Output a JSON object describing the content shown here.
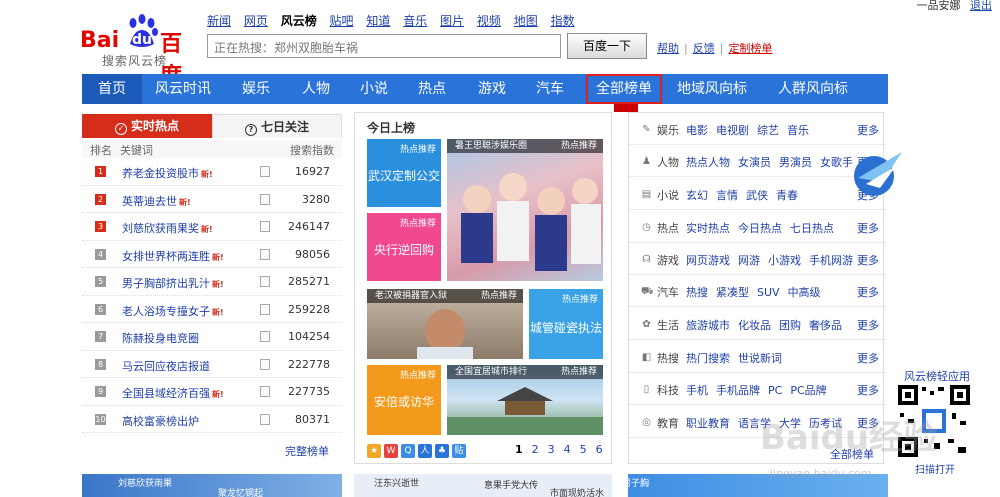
{
  "user": {
    "name": "一品安娜",
    "logout": "退出"
  },
  "logo": {
    "bai": "Bai",
    "du": "du",
    "baidu_cn": "百度",
    "sub": "搜索风云榜"
  },
  "prodnav": [
    "新闻",
    "网页",
    "风云榜",
    "贴吧",
    "知道",
    "音乐",
    "图片",
    "视频",
    "地图",
    "指数"
  ],
  "search": {
    "placeholder": "正在热搜：郑州双胞胎车祸",
    "button": "百度一下"
  },
  "links": {
    "help": "帮助",
    "feedback": "反馈",
    "custom": "定制榜单"
  },
  "mainnav": [
    "首页",
    "风云时讯",
    "娱乐",
    "人物",
    "小说",
    "热点",
    "游戏",
    "汽车",
    "全部榜单",
    "地域风向标",
    "人群风向标"
  ],
  "leftpanel": {
    "tab1": "实时热点",
    "tab2": "七日关注",
    "head_rank": "排名",
    "head_kw": "关键词",
    "head_idx": "搜索指数",
    "rows": [
      {
        "rank": "1",
        "kw": "养老金投资股市",
        "isnew": true,
        "num": "16927"
      },
      {
        "rank": "2",
        "kw": "英蒂迪去世",
        "isnew": true,
        "num": "3280"
      },
      {
        "rank": "3",
        "kw": "刘慈欣获雨果奖",
        "isnew": true,
        "num": "246147"
      },
      {
        "rank": "4",
        "kw": "女排世界杯两连胜",
        "isnew": true,
        "num": "98056"
      },
      {
        "rank": "5",
        "kw": "男子胸部挤出乳汁",
        "isnew": true,
        "num": "285271"
      },
      {
        "rank": "6",
        "kw": "老人浴场专撞女子",
        "isnew": true,
        "num": "259228"
      },
      {
        "rank": "7",
        "kw": "陈赫投身电竞圈",
        "isnew": false,
        "num": "104254"
      },
      {
        "rank": "8",
        "kw": "马云回应夜店报道",
        "isnew": false,
        "num": "222778"
      },
      {
        "rank": "9",
        "kw": "全国县域经济百强",
        "isnew": true,
        "num": "227735"
      },
      {
        "rank": "10",
        "kw": "高校富豪榜出炉",
        "isnew": false,
        "num": "80371"
      }
    ],
    "new_label": "新!",
    "more": "完整榜单"
  },
  "midpanel": {
    "title": "今日上榜",
    "tag": "热点推荐",
    "t1": "武汉定制公交",
    "t2": "央行逆回购",
    "p1": "暑王思聪涉娱乐圈",
    "p2": "老汉被捐器官入狱",
    "t3": "城管碰瓷执法",
    "t4": "安倍或访华",
    "p3": "全国宜居城市排行",
    "pages": [
      "1",
      "2",
      "3",
      "4",
      "5",
      "6"
    ]
  },
  "rightpanel": {
    "rows": [
      {
        "icon": "✎",
        "name": "娱乐",
        "links": [
          "电影",
          "电视剧",
          "综艺",
          "音乐"
        ]
      },
      {
        "icon": "♟",
        "name": "人物",
        "links": [
          "热点人物",
          "女演员",
          "男演员",
          "女歌手"
        ]
      },
      {
        "icon": "▤",
        "name": "小说",
        "links": [
          "玄幻",
          "言情",
          "武侠",
          "青春"
        ]
      },
      {
        "icon": "◷",
        "name": "热点",
        "links": [
          "实时热点",
          "今日热点",
          "七日热点"
        ]
      },
      {
        "icon": "☊",
        "name": "游戏",
        "links": [
          "网页游戏",
          "网游",
          "小游戏",
          "手机网游"
        ]
      },
      {
        "icon": "⛟",
        "name": "汽车",
        "links": [
          "热搜",
          "紧凑型",
          "SUV",
          "中高级"
        ]
      },
      {
        "icon": "✿",
        "name": "生活",
        "links": [
          "旅游城市",
          "化妆品",
          "团购",
          "奢侈品"
        ]
      },
      {
        "icon": "◧",
        "name": "热搜",
        "links": [
          "热门搜索",
          "世说新词"
        ]
      },
      {
        "icon": "▯",
        "name": "科技",
        "links": [
          "手机",
          "手机品牌",
          "PC",
          "PC品牌"
        ]
      },
      {
        "icon": "◎",
        "name": "教育",
        "links": [
          "职业教育",
          "语言学",
          "大学",
          "历考试"
        ]
      }
    ],
    "more": "更多",
    "all": "全部榜单"
  },
  "qr": {
    "label": "风云榜轻应用",
    "scan": "扫描打开"
  },
  "bottom": [
    "刘慈欣获雨果",
    "聚龙忆钢起",
    "汪东兴逝世",
    "意果手党大传",
    "市面现奶活水",
    "男子胸"
  ],
  "watermark": {
    "text": "Baidu经验",
    "url": "jingyan.baidu.com"
  },
  "colors": {
    "nav_blue": "#2a73d9",
    "red": "#d62c1a",
    "link": "#1f3fa8"
  }
}
